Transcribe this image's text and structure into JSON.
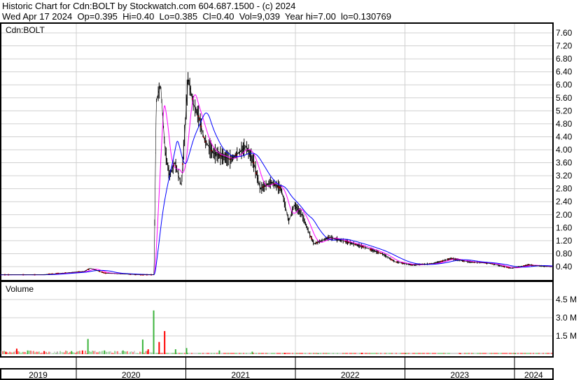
{
  "header": {
    "line1": "Historic Chart for Cdn:BOLT by Stockwatch.com 604.687.1500 - (c) 2024",
    "line2": "Wed Apr 17 2024  Op=0.395  Hi=0.40  Lo=0.385  Cl=0.40  Vol=9,039  Year hi=7.00  lo=0.130769"
  },
  "chart_data": [
    {
      "type": "line",
      "title": "Cdn:BOLT",
      "yticks": [
        "7.60",
        "7.20",
        "6.80",
        "6.40",
        "6.00",
        "5.60",
        "5.20",
        "4.80",
        "4.40",
        "4.00",
        "3.60",
        "3.20",
        "2.80",
        "2.40",
        "2.00",
        "1.60",
        "1.20",
        "0.80",
        "0.40"
      ],
      "ylim": [
        0,
        7.8
      ],
      "xlim": [
        2019.3,
        2024.35
      ],
      "x": [
        2019.3,
        2019.69,
        2020.07,
        2020.13,
        2020.26,
        2020.58,
        2020.71,
        2020.73,
        2020.77,
        2020.81,
        2020.85,
        2020.9,
        2020.96,
        2021.02,
        2021.07,
        2021.12,
        2021.17,
        2021.25,
        2021.41,
        2021.55,
        2021.62,
        2021.68,
        2021.78,
        2021.87,
        2021.94,
        2021.99,
        2022.06,
        2022.13,
        2022.17,
        2022.31,
        2022.43,
        2022.63,
        2022.79,
        2022.91,
        2023.07,
        2023.27,
        2023.42,
        2023.58,
        2023.78,
        2023.97,
        2024.13,
        2024.32
      ],
      "close": [
        0.15,
        0.15,
        0.25,
        0.35,
        0.2,
        0.15,
        0.15,
        5.5,
        6.0,
        4.0,
        3.2,
        3.6,
        2.9,
        6.2,
        5.4,
        5.0,
        4.3,
        3.9,
        3.7,
        4.1,
        3.6,
        2.8,
        3.0,
        2.8,
        1.8,
        2.3,
        2.0,
        1.4,
        1.1,
        1.3,
        1.2,
        1.0,
        0.8,
        0.55,
        0.45,
        0.5,
        0.65,
        0.55,
        0.5,
        0.35,
        0.45,
        0.4
      ],
      "series": [
        {
          "name": "Price",
          "color": "#000000"
        },
        {
          "name": "Short MA",
          "color": "#ff00ff"
        },
        {
          "name": "Long MA",
          "color": "#0000ff"
        }
      ]
    },
    {
      "type": "bar",
      "title": "Volume",
      "yticks": [
        "4.5 M",
        "3.0 M",
        "1.5 M"
      ],
      "ylim": [
        0,
        6
      ],
      "x": [
        2019.35,
        2019.45,
        2019.55,
        2019.7,
        2019.82,
        2019.95,
        2020.05,
        2020.1,
        2020.25,
        2020.42,
        2020.6,
        2020.65,
        2020.7,
        2020.75,
        2020.8,
        2020.9,
        2021.0,
        2021.3,
        2021.6,
        2021.9,
        2022.2,
        2022.6,
        2023.0,
        2023.5,
        2024.0
      ],
      "values": [
        0.2,
        0.45,
        0.3,
        0.25,
        0.2,
        0.25,
        0.3,
        1.25,
        0.3,
        0.3,
        1.2,
        0.4,
        3.6,
        1.0,
        1.9,
        0.4,
        0.5,
        0.3,
        0.2,
        0.1,
        0.08,
        0.1,
        0.08,
        0.08,
        0.08
      ],
      "colors": [
        "#ff0000",
        "#ff0000",
        "#3cb43c",
        "#ff0000",
        "#aaaaaa",
        "#3cb43c",
        "#ff0000",
        "#3cb43c",
        "#3cb43c",
        "#3cb43c",
        "#3cb43c",
        "#ff0000",
        "#3cb43c",
        "#ff0000",
        "#ff0000",
        "#3cb43c",
        "#3cb43c",
        "#3cb43c",
        "#3cb43c",
        "#ff0000",
        "#3cb43c",
        "#ff0000",
        "#3cb43c",
        "#ff0000",
        "#3cb43c"
      ]
    },
    {
      "type": "axis",
      "years": [
        "2019",
        "2020",
        "2021",
        "2022",
        "2023",
        "2024"
      ]
    }
  ]
}
